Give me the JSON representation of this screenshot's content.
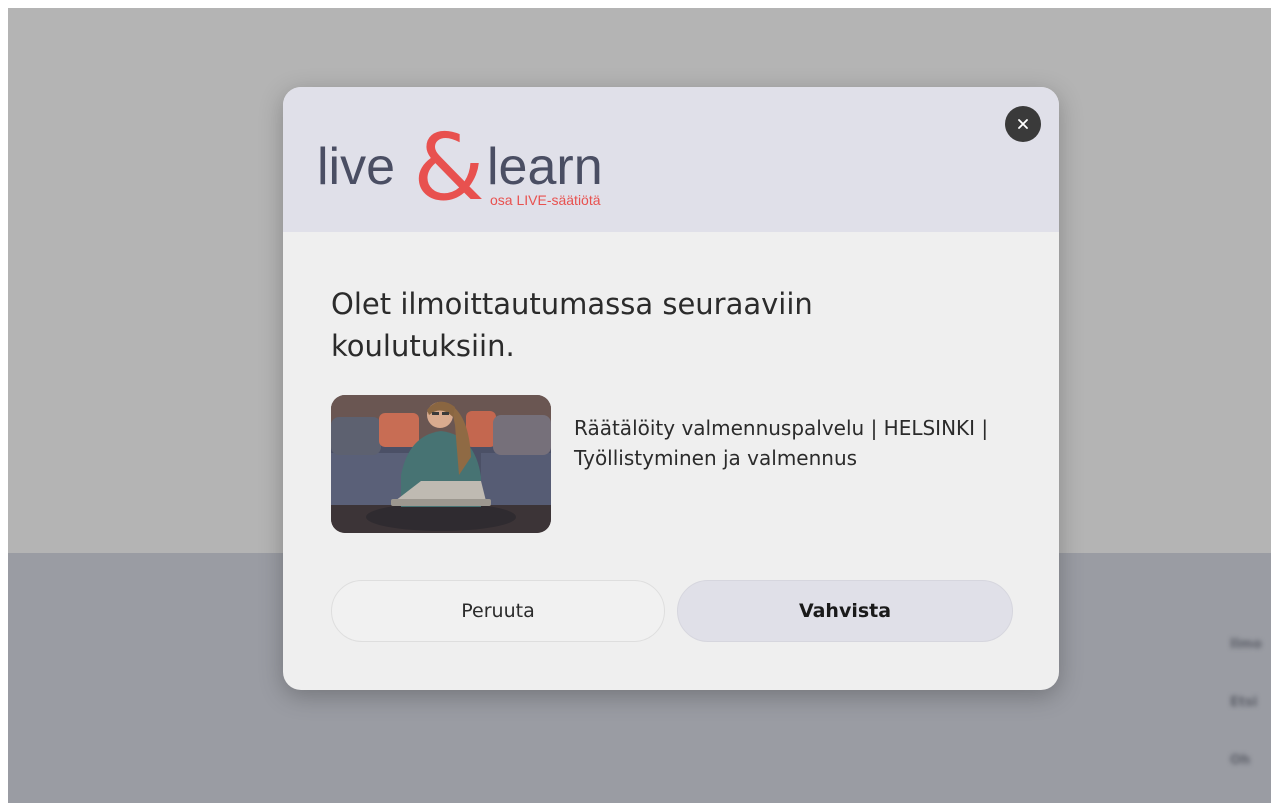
{
  "background": {
    "side_links": [
      "Ilmo",
      "Etsi",
      "Oh"
    ]
  },
  "modal": {
    "logo": {
      "word_left": "live",
      "ampersand": "&",
      "word_right": "learn",
      "tagline": "osa LIVE-säätiötä"
    },
    "close_icon": "close-icon",
    "title": "Olet ilmoittautumassa seuraaviin koulutuksiin.",
    "course": {
      "title": "Räätälöity valmennuspalvelu | HELSINKI | Työllistyminen ja valmennus"
    },
    "buttons": {
      "cancel_label": "Peruuta",
      "confirm_label": "Vahvista"
    }
  },
  "colors": {
    "brand_red": "#e8514f",
    "brand_dark": "#4a4e63",
    "header_bg": "#e0e0e9",
    "modal_bg": "#efefef"
  }
}
